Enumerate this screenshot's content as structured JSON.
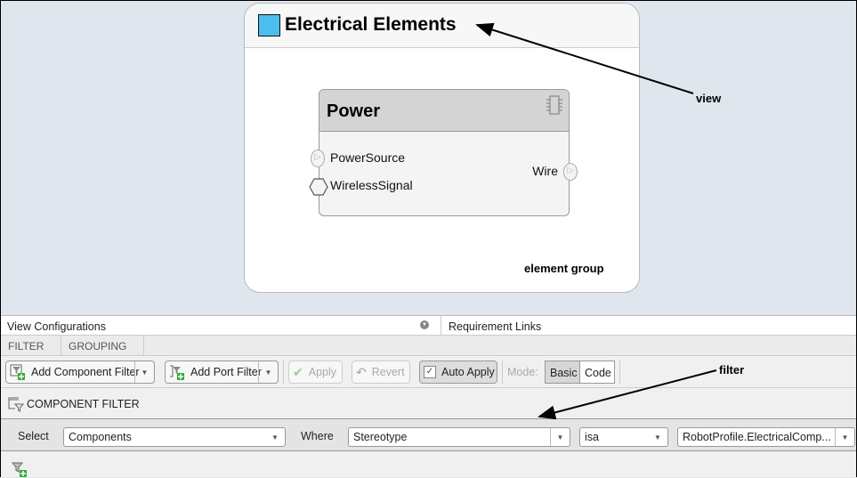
{
  "colors": {
    "accent_swatch": "#4cbdf0",
    "canvas_bg": "#dfe6ee"
  },
  "view": {
    "title": "Electrical Elements",
    "component": {
      "name": "Power",
      "icon": "chip-icon",
      "ports_left": [
        "PowerSource",
        "WirelessSignal"
      ],
      "ports_right": [
        "Wire"
      ]
    },
    "group_label": "element group"
  },
  "annotations": {
    "view": "view",
    "filter": "filter"
  },
  "panel": {
    "header_left": "View Configurations",
    "header_right": "Requirement Links",
    "tabs": [
      "FILTER",
      "GROUPING"
    ],
    "toolbar": {
      "add_component_filter": "Add Component Filter",
      "add_port_filter": "Add Port Filter",
      "apply": "Apply",
      "revert": "Revert",
      "auto_apply": "Auto Apply",
      "auto_apply_checked": true,
      "mode_label": "Mode:",
      "mode_basic": "Basic",
      "mode_code": "Code",
      "mode_selected": "Basic"
    },
    "section_title": "COMPONENT FILTER",
    "filter": {
      "select_label": "Select",
      "select_value": "Components",
      "where_label": "Where",
      "where_value": "Stereotype",
      "op_value": "isa",
      "value": "RobotProfile.ElectricalComp..."
    }
  }
}
